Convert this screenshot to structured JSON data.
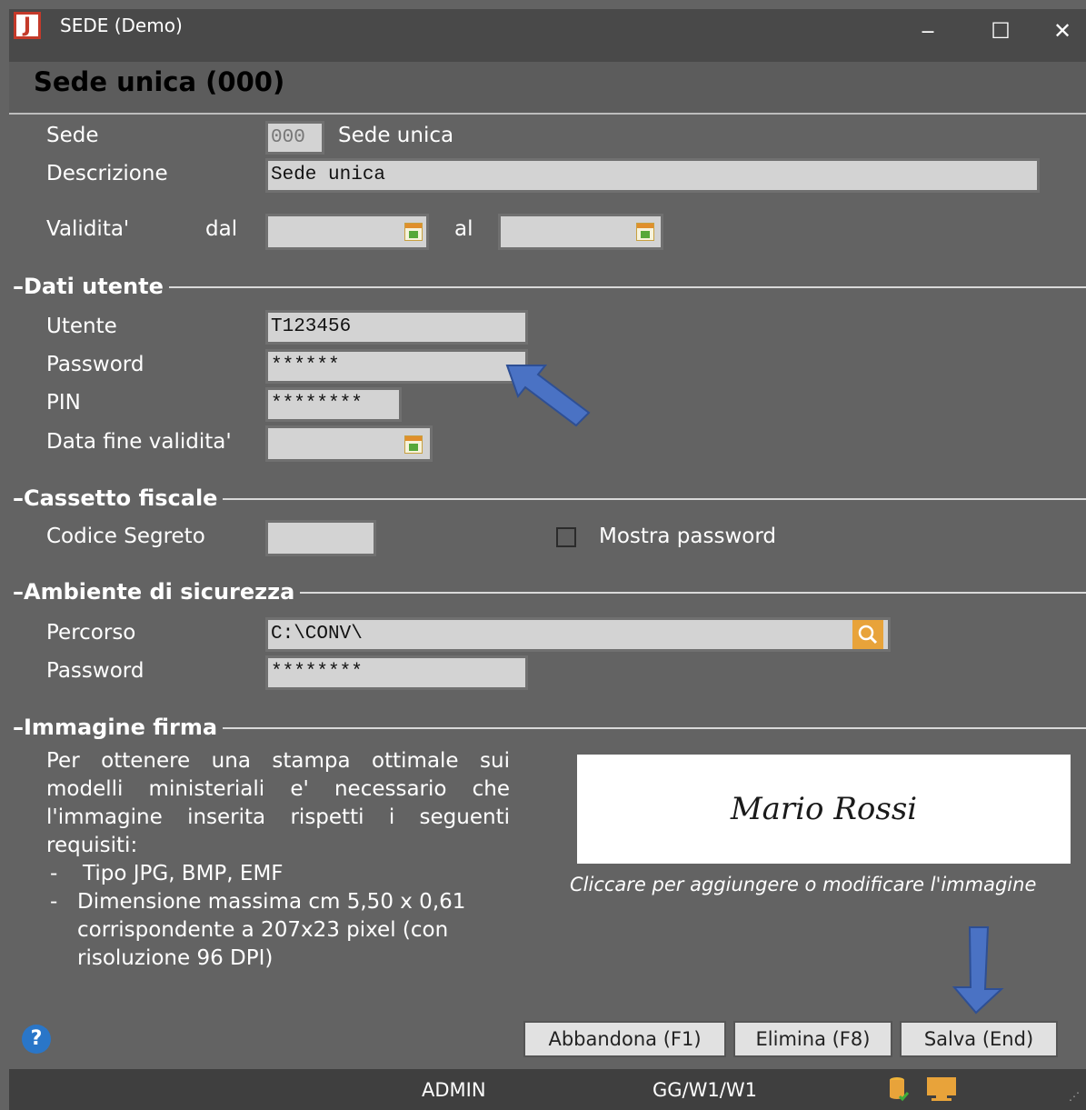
{
  "window": {
    "title": "SEDE (Demo)",
    "icon_letter": "J",
    "minimize": "‒",
    "maximize": "☐",
    "close": "✕"
  },
  "header": {
    "title": "Sede unica (000)"
  },
  "main": {
    "sede_label": "Sede",
    "sede_code": "000",
    "sede_name": "Sede unica",
    "descrizione_label": "Descrizione",
    "descrizione_value": "Sede unica",
    "validita_label": "Validita'",
    "dal_label": "dal",
    "al_label": "al",
    "dal_value": "",
    "al_value": ""
  },
  "dati_utente": {
    "title": "Dati utente",
    "utente_label": "Utente",
    "utente_value": "T123456",
    "password_label": "Password",
    "password_value": "******",
    "pin_label": "PIN",
    "pin_value": "********",
    "fine_label": "Data fine validita'",
    "fine_value": ""
  },
  "cassetto": {
    "title": "Cassetto fiscale",
    "codice_label": "Codice Segreto",
    "codice_value": "",
    "mostra_label": "Mostra password",
    "mostra_checked": false
  },
  "ambiente": {
    "title": "Ambiente di sicurezza",
    "percorso_label": "Percorso",
    "percorso_value": "C:\\CONV\\",
    "password_label": "Password",
    "password_value": "********"
  },
  "firma": {
    "title": "Immagine firma",
    "info": "Per ottenere una stampa ottimale sui modelli ministeriali e' necessario che l'immagine inserita rispetti i seguenti requisiti:",
    "req1": "Tipo JPG, BMP, EMF",
    "req2": "Dimensione massima cm 5,50 x 0,61 corrispondente a 207x23 pixel (con risoluzione 96 DPI)",
    "signature": "Mario Rossi",
    "caption": "Cliccare per aggiungere o modificare l'immagine"
  },
  "buttons": {
    "help": "?",
    "abbandona": "Abbandona (F1)",
    "elimina": "Elimina (F8)",
    "salva": "Salva (End)"
  },
  "status": {
    "user": "ADMIN",
    "path": "GG/W1/W1"
  },
  "colors": {
    "arrow": "#4a72c4",
    "accent_icon": "#e8a33a"
  }
}
